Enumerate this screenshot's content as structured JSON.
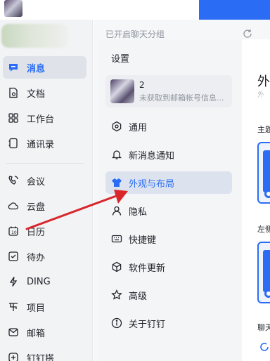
{
  "sidebar": {
    "items": [
      {
        "label": "消息",
        "icon": "message-icon",
        "active": true
      },
      {
        "label": "文档",
        "icon": "document-icon"
      },
      {
        "label": "工作台",
        "icon": "workbench-icon"
      },
      {
        "label": "通讯录",
        "icon": "contacts-icon"
      },
      {
        "label": "会议",
        "icon": "meeting-icon"
      },
      {
        "label": "云盘",
        "icon": "cloud-icon"
      },
      {
        "label": "日历",
        "icon": "calendar-icon"
      },
      {
        "label": "待办",
        "icon": "todo-icon"
      },
      {
        "label": "DING",
        "icon": "ding-icon"
      },
      {
        "label": "项目",
        "icon": "project-icon"
      },
      {
        "label": "邮箱",
        "icon": "mail-icon"
      },
      {
        "label": "钉钉搭",
        "icon": "dingda-icon"
      }
    ]
  },
  "chat_list": {
    "header": "已开启聊天分组"
  },
  "settings": {
    "title": "设置",
    "account": {
      "name": "2",
      "subtitle": "未获取到邮箱帐号信息..."
    },
    "items": [
      {
        "label": "通用",
        "icon": "general-icon"
      },
      {
        "label": "新消息通知",
        "icon": "bell-icon"
      },
      {
        "label": "外观与布局",
        "icon": "shirt-icon",
        "active": true
      },
      {
        "label": "隐私",
        "icon": "privacy-icon"
      },
      {
        "label": "快捷键",
        "icon": "keyboard-icon"
      },
      {
        "label": "软件更新",
        "icon": "update-icon"
      },
      {
        "label": "高级",
        "icon": "star-icon"
      },
      {
        "label": "关于钉钉",
        "icon": "info-icon"
      }
    ]
  },
  "content": {
    "title": "外",
    "subtitle": "外",
    "theme_label": "主题",
    "left_label": "左侧",
    "chat_label": "聊天"
  },
  "colors": {
    "accent": "#2a6df4",
    "arrow": "#d9262b"
  }
}
